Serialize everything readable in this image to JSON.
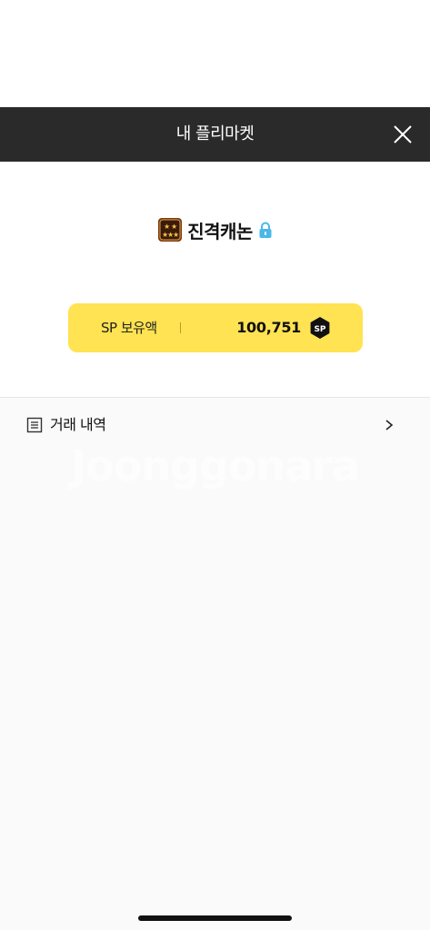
{
  "header": {
    "title": "내 플리마켓"
  },
  "profile": {
    "nickname": "진격캐논"
  },
  "sp_balance": {
    "label": "SP 보유액",
    "value": "100,751",
    "coin_text": "SP"
  },
  "menu": {
    "history_label": "거래 내역"
  },
  "watermark": {
    "text": "Joonggonara"
  },
  "colors": {
    "header_bg": "#2a2a2a",
    "card_bg": "#ffe352",
    "lock": "#4ab8e8"
  }
}
